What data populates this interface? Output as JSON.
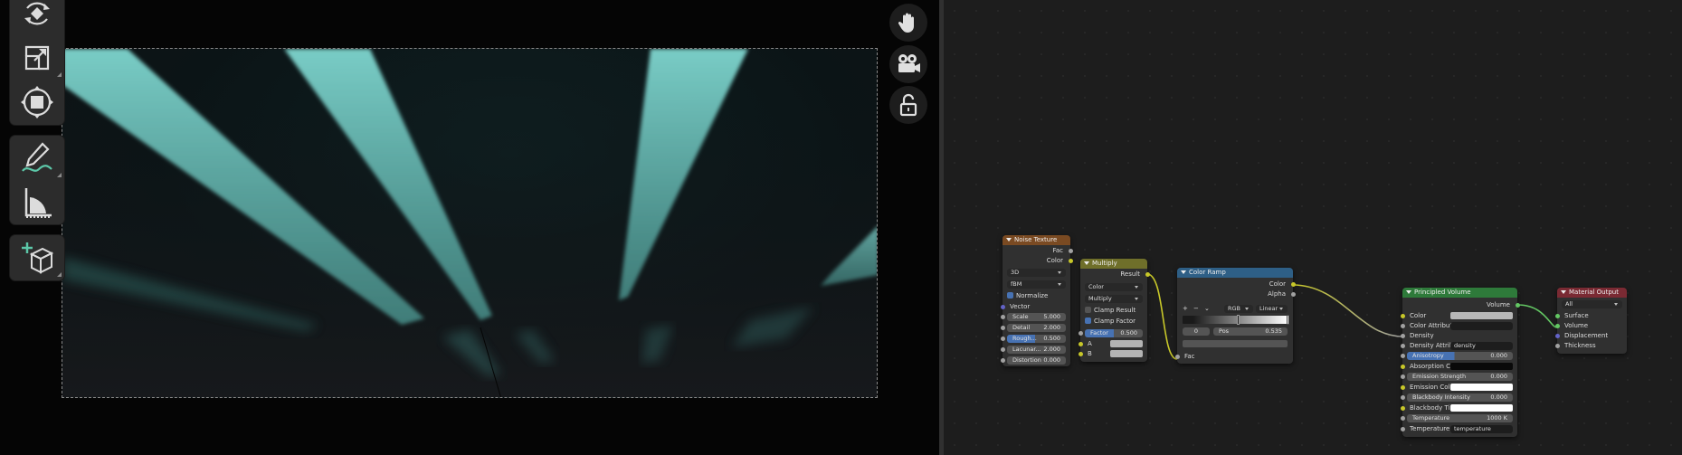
{
  "viewport": {
    "tools": [
      {
        "name": "rotate-icon"
      },
      {
        "name": "scale-icon"
      },
      {
        "name": "transform-icon"
      },
      {
        "name": "annotate-icon"
      },
      {
        "name": "measure-icon"
      },
      {
        "name": "add-cube-icon"
      }
    ],
    "nav": [
      {
        "name": "hand-icon"
      },
      {
        "name": "camera-icon"
      },
      {
        "name": "lock-icon"
      }
    ],
    "render_colors": {
      "beam": "#7fd6cf",
      "background": "#0b1416"
    }
  },
  "nodes": {
    "noise": {
      "title": "Noise Texture",
      "header_color": "#7a4a22",
      "outputs": [
        "Fac",
        "Color"
      ],
      "dimension": "3D",
      "type": "fBM",
      "normalize_label": "Normalize",
      "vector_label": "Vector",
      "fields": [
        {
          "label": "Scale",
          "value": "5.000"
        },
        {
          "label": "Detail",
          "value": "2.000"
        },
        {
          "label": "Rough...",
          "value": "0.500"
        },
        {
          "label": "Lacunar...",
          "value": "2.000"
        },
        {
          "label": "Distortion",
          "value": "0.000"
        }
      ]
    },
    "multiply": {
      "title": "Multiply",
      "header_color": "#6f6f2a",
      "output": "Result",
      "type": "Color",
      "blend": "Multiply",
      "clamp_result": "Clamp Result",
      "clamp_factor": "Clamp Factor",
      "factor_label": "Factor",
      "factor_value": "0.500",
      "a_label": "A",
      "b_label": "B"
    },
    "ramp": {
      "title": "Color Ramp",
      "header_color": "#2e5f86",
      "outputs": [
        "Color",
        "Alpha"
      ],
      "plus": "+",
      "minus": "−",
      "chev": "⌄",
      "mode": "RGB",
      "interp": "Linear",
      "stop_index": "0",
      "pos_label": "Pos",
      "pos_value": "0.535",
      "input": "Fac"
    },
    "volume": {
      "title": "Principled Volume",
      "header_color": "#2e7a3a",
      "output": "Volume",
      "color_label": "Color",
      "color_attr_label": "Color Attribute",
      "density_label": "Density",
      "density_attr_label": "Density Attrib...",
      "density_attr_value": "density",
      "anisotropy_label": "Anisotropy",
      "anisotropy_value": "0.000",
      "absorption_label": "Absorption C...",
      "emission_strength_label": "Emission Strength",
      "emission_strength_value": "0.000",
      "emission_color_label": "Emission Color",
      "blackbody_intensity_label": "Blackbody Intensity",
      "blackbody_intensity_value": "0.000",
      "blackbody_tint_label": "Blackbody Tint",
      "temperature_label": "Temperature",
      "temperature_value": "1000 K",
      "temperature_attr_label": "Temperature ...",
      "temperature_attr_value": "temperature"
    },
    "output": {
      "title": "Material Output",
      "header_color": "#7a2a33",
      "target": "All",
      "inputs": [
        "Surface",
        "Volume",
        "Displacement",
        "Thickness"
      ]
    }
  }
}
